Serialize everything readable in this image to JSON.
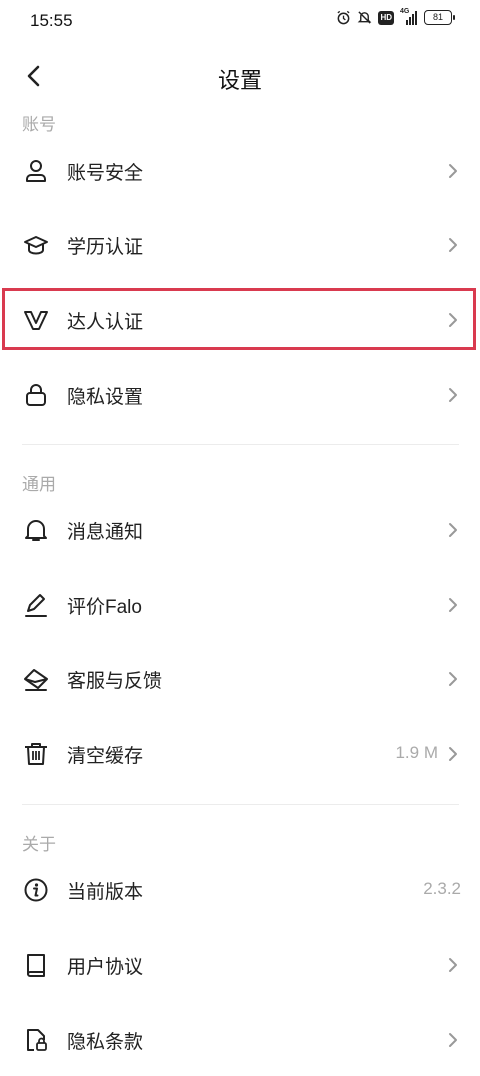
{
  "status_bar": {
    "time": "15:55",
    "hd": "HD",
    "network": "4G",
    "battery": "81"
  },
  "header": {
    "title": "设置"
  },
  "sections": {
    "account": "账号",
    "general": "通用",
    "about": "关于"
  },
  "rows": {
    "account_security": {
      "label": "账号安全",
      "icon": "person-icon"
    },
    "education": {
      "label": "学历认证",
      "icon": "graduation-cap-icon"
    },
    "expert": {
      "label": "达人认证",
      "icon": "v-badge-icon"
    },
    "privacy_settings": {
      "label": "隐私设置",
      "icon": "lock-icon"
    },
    "notifications": {
      "label": "消息通知",
      "icon": "bell-icon"
    },
    "rate": {
      "label": "评价Falo",
      "icon": "pen-icon"
    },
    "feedback": {
      "label": "客服与反馈",
      "icon": "envelope-icon"
    },
    "clear_cache": {
      "label": "清空缓存",
      "value": "1.9 M",
      "icon": "trash-icon"
    },
    "version": {
      "label": "当前版本",
      "value": "2.3.2",
      "icon": "info-icon"
    },
    "user_agreement": {
      "label": "用户协议",
      "icon": "book-icon"
    },
    "privacy_policy": {
      "label": "隐私条款",
      "icon": "document-lock-icon"
    }
  },
  "colors": {
    "highlight": "#d93a4f",
    "muted": "#aaaaaa",
    "text": "#222222"
  }
}
